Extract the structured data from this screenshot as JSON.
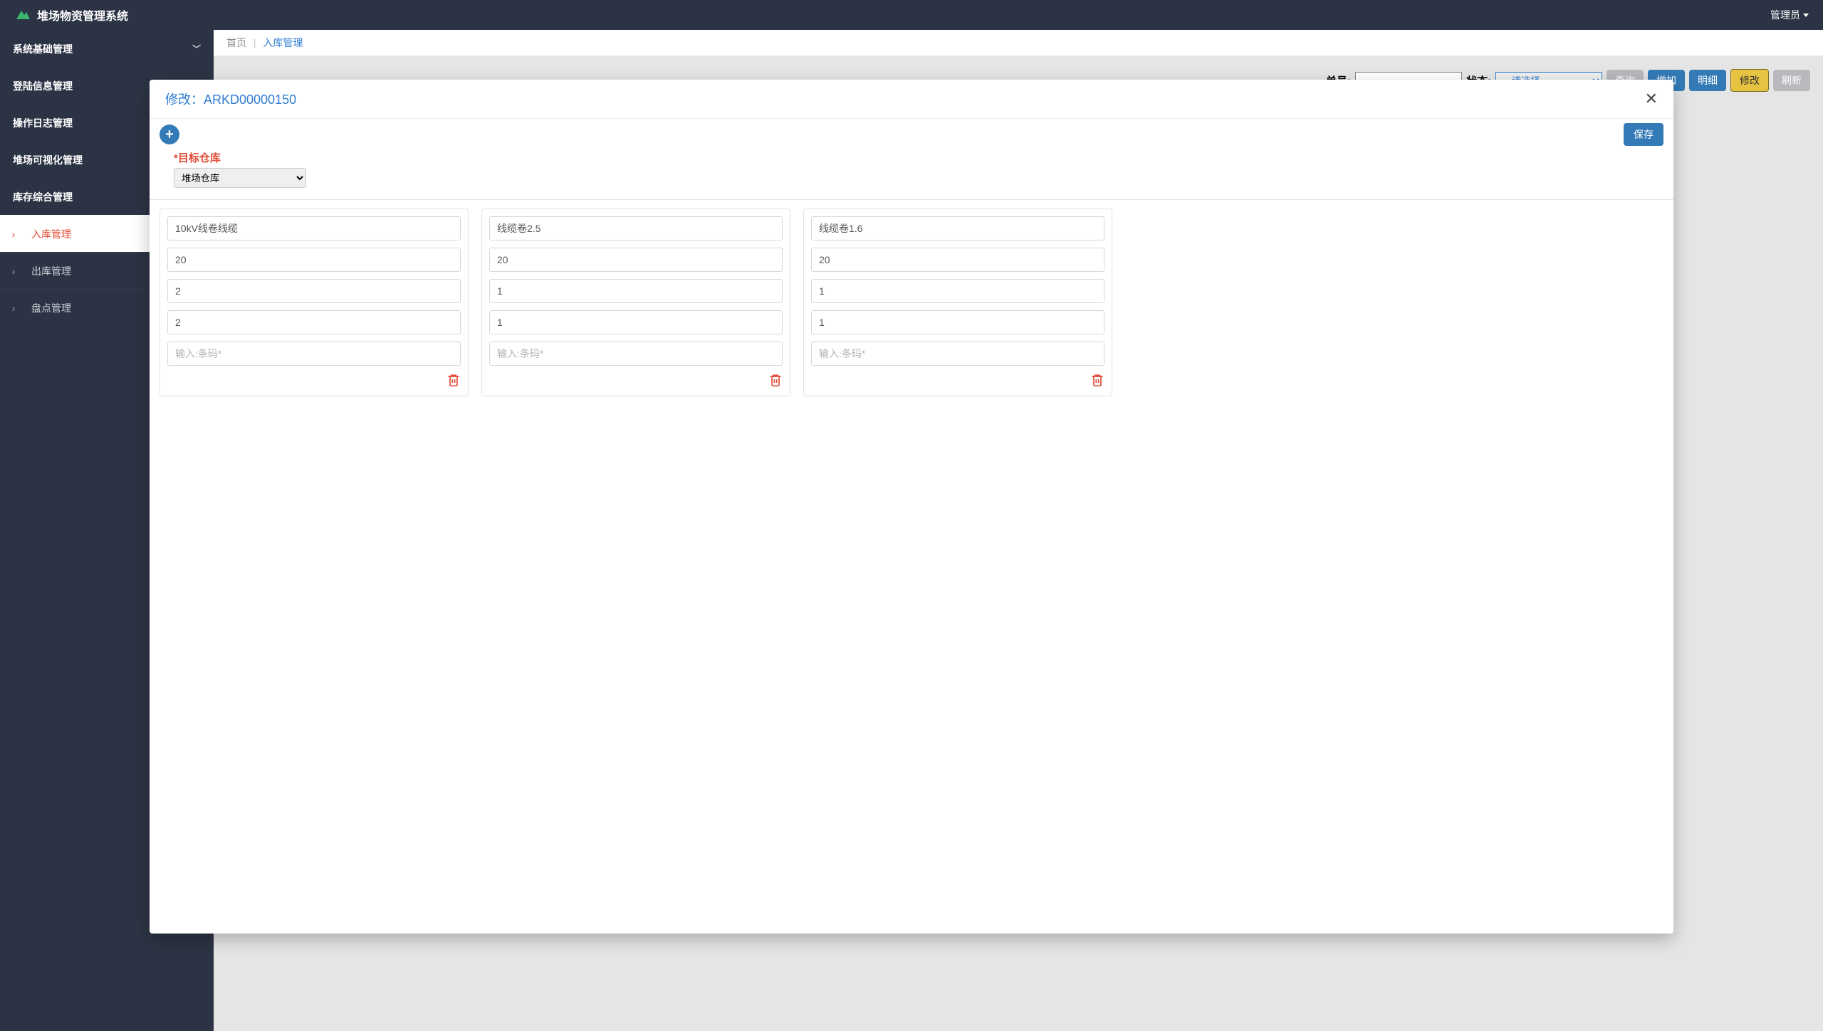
{
  "header": {
    "app_title": "堆场物资管理系统",
    "user_label": "管理员"
  },
  "sidebar": {
    "items": [
      {
        "label": "系统基础管理",
        "expanded": false
      },
      {
        "label": "登陆信息管理",
        "expanded": false
      },
      {
        "label": "操作日志管理",
        "expanded": false
      },
      {
        "label": "堆场可视化管理",
        "expanded": null
      },
      {
        "label": "库存综合管理",
        "expanded": true
      }
    ],
    "sub_items": [
      {
        "label": "入库管理",
        "active": true
      },
      {
        "label": "出库管理",
        "active": false
      },
      {
        "label": "盘点管理",
        "active": false
      }
    ]
  },
  "breadcrumb": {
    "home": "首页",
    "current": "入库管理"
  },
  "filters": {
    "order_label": "单号:",
    "order_value": "",
    "status_label": "状态:",
    "status_value": "----请选择----",
    "btn_query": "查询",
    "btn_add": "增加",
    "btn_detail": "明细",
    "btn_edit": "修改",
    "btn_refresh": "刷新"
  },
  "modal": {
    "title_prefix": "修改：",
    "order_id": "ARKD00000150",
    "save_label": "保存",
    "target_label": "*目标仓库",
    "target_value": "堆场仓库",
    "barcode_placeholder": "输入:条码*",
    "cards": [
      {
        "name": "10kV线卷线缆",
        "f2": "20",
        "f3": "2",
        "f4": "2",
        "barcode": ""
      },
      {
        "name": "线缆卷2.5",
        "f2": "20",
        "f3": "1",
        "f4": "1",
        "barcode": ""
      },
      {
        "name": "线缆卷1.6",
        "f2": "20",
        "f3": "1",
        "f4": "1",
        "barcode": ""
      }
    ]
  }
}
